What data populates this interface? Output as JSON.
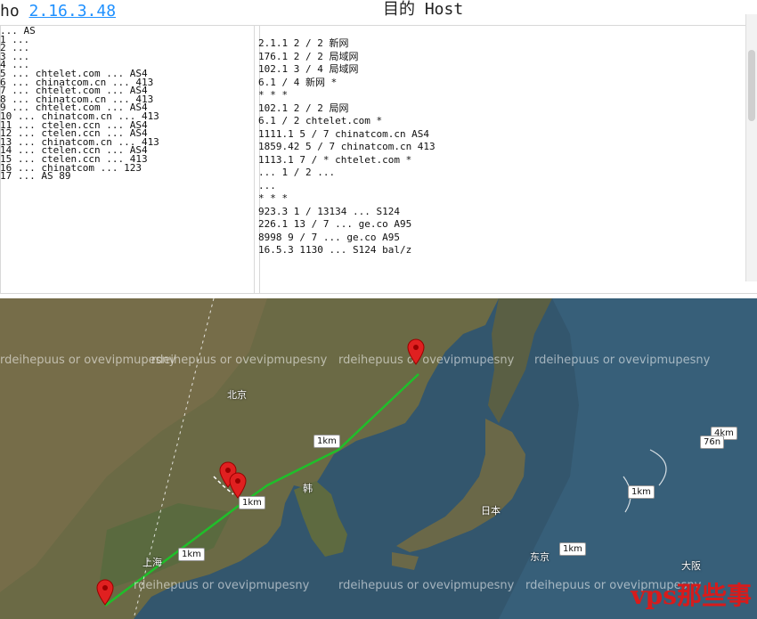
{
  "trace": {
    "header_prefix": "ho",
    "header_ip": "2.16.3.48",
    "header_dest": "目的 Host",
    "left_rows": [
      "...  AS",
      "1  ...",
      "2  ...",
      "3  ...",
      "4  ...",
      "5  ...  chtelet.com ... AS4",
      "6  ... chinatcom.cn ... 413",
      "7  ... chtelet.com ... AS4",
      "8  ... chinatcom.cn ... 413",
      "9  ... chtelet.com ... AS4",
      "10 ... chinatcom.cn ... 413",
      "11 ... ctelen.ccn ... AS4",
      "12 ... ctelen.ccn ... AS4",
      "13 ... chinatcom.cn ... 413",
      "14 ... ctelen.ccn ... AS4",
      "15 ... ctelen.ccn ... 413",
      "16 ... chinatcom ... 123",
      "17 ... AS 89"
    ],
    "right_rows": [
      "2.1.1     2 / 2   新网",
      "176.1     2 / 2   局域网",
      "102.1     3 / 4   局域网",
      "6.1       / 4   新网  *",
      "*  *  *",
      "102.1     2 / 2   局网",
      "6.1       / 2   chtelet.com  *",
      "1111.1    5 / 7   chinatcom.cn  AS4",
      "1859.42   5 / 7   chinatcom.cn  413",
      "1113.1    7 / *   chtelet.com  *",
      "...       1 / 2   ...",
      "...",
      "*  *  *",
      "923.3     1 / 13134   ...  S124",
      "226.1     13 / 7   ... ge.co  A95",
      "8998      9 / 7   ... ge.co  A95",
      "16.5.3    1130   ... S124   bal/z"
    ]
  },
  "map": {
    "watermark_text": "rdeihepuus or ovevipmupesny",
    "brand": "vps那些事",
    "distance_labels": [
      "1km",
      "1km",
      "1km",
      "4km",
      "76n",
      "1km",
      "1km"
    ],
    "places": [
      "上海",
      "北京",
      "韩",
      "东京",
      "大阪",
      "日本"
    ]
  }
}
